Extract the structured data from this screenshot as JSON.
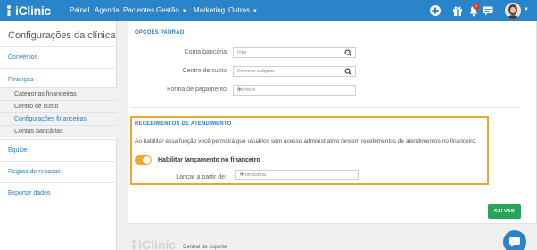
{
  "app": {
    "brand": "iClinic",
    "brand_color": "#2a84c9",
    "accent_color": "#f0a532",
    "success_color": "#27a45a"
  },
  "topnav": {
    "items": [
      {
        "label": "Painel",
        "has_dropdown": false
      },
      {
        "label": "Agenda",
        "has_dropdown": false
      },
      {
        "label": "Pacientes",
        "has_dropdown": false
      },
      {
        "label": "Gestão",
        "has_dropdown": true
      },
      {
        "label": "Marketing",
        "has_dropdown": false
      },
      {
        "label": "Outros",
        "has_dropdown": true
      }
    ],
    "icons": [
      "add-circle-icon",
      "gift-icon",
      "bell-icon",
      "chat-icon"
    ],
    "notification_count": "1"
  },
  "sidebar": {
    "title": "Configurações da clínica",
    "items": [
      {
        "label": "Convênios"
      },
      {
        "label": "Finanças",
        "subitems": [
          {
            "label": "Categorias financeiras",
            "active": false
          },
          {
            "label": "Centro de custo",
            "active": false
          },
          {
            "label": "Configurações financeiras",
            "active": true
          },
          {
            "label": "Contas bancárias",
            "active": false
          }
        ]
      },
      {
        "label": "Equipe"
      },
      {
        "label": "Regras de repasse"
      },
      {
        "label": "Exportar dados"
      }
    ]
  },
  "defaults_section": {
    "title": "OPÇÕES PADRÃO",
    "fields": [
      {
        "label": "Conta bancária",
        "value": "Inter",
        "icon": "search-icon"
      },
      {
        "label": "Centro de custo",
        "placeholder": "Comece a digitar",
        "icon": "search-icon"
      },
      {
        "label": "Forma de pagamento",
        "value": "Dinheiro",
        "icon": "chevron-down-icon"
      }
    ]
  },
  "receipts_section": {
    "title": "RECEBIMENTOS DE ATENDIMENTO",
    "description": "Ao habilitar essa função você permitirá que usuários sem acesso administrativo lancem recebimentos de atendimentos no financeiro.",
    "toggle_label": "Habilitar lançamento no financeiro",
    "toggle_on": true,
    "launch_from_label": "Lançar a partir de:",
    "launch_from_value": "Promissória"
  },
  "actions": {
    "save_label": "SALVAR"
  },
  "footer": {
    "brand": "iClinic",
    "support_link": "Central de suporte"
  }
}
